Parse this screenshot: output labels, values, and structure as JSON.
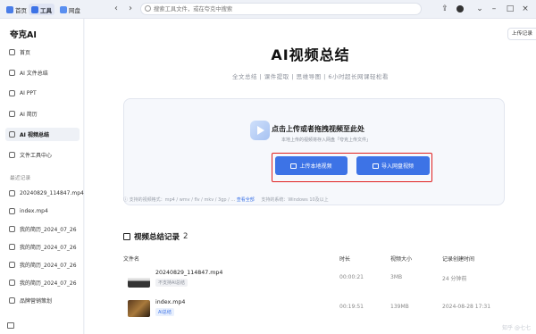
{
  "topbar": {
    "tabs": [
      {
        "label": "首页",
        "icon": "home-icon",
        "color": "#4a7de8"
      },
      {
        "label": "工具",
        "icon": "tools-icon",
        "color": "#3d73e6"
      },
      {
        "label": "网盘",
        "icon": "cloud-drive-icon",
        "color": "#5a8ff0"
      }
    ],
    "search_placeholder": "搜索工具文件，或在夸克中搜索"
  },
  "sidebar": {
    "brand": "夸克AI",
    "items": [
      {
        "label": "首页",
        "icon": "home-icon"
      },
      {
        "label": "AI 文件总结",
        "icon": "document-icon"
      },
      {
        "label": "AI PPT",
        "icon": "ppt-icon"
      },
      {
        "label": "AI 简历",
        "icon": "resume-icon"
      },
      {
        "label": "AI 视频总结",
        "icon": "video-icon",
        "active": true
      },
      {
        "label": "文件工具中心",
        "icon": "toolbox-icon"
      }
    ],
    "recent_header": "最近记录",
    "recent": [
      "20240829_114847.mp4",
      "index.mp4",
      "我的简历_2024_07_26",
      "我的简历_2024_07_26",
      "我的简历_2024_07_26",
      "我的简历_2024_07_26",
      "品牌营销策划"
    ]
  },
  "main": {
    "upload_record_button": "上传记录",
    "title": "AI视频总结",
    "subtitle": "全文总结 | 课件提取 | 思维导图 | 6小时超长网课轻松看",
    "upload": {
      "main_text": "点击上传或者拖拽视频至此处",
      "hint": "本地上传的视频将存入网盘「夸克上传文件」",
      "local_button": "上传本地视频",
      "cloud_button": "导入网盘视频",
      "formats": "支持的视频格式：mp4 / wmv / flv / mkv / 3gp / ...",
      "formats_link": "查看全部",
      "system": "支持的系统：Windows 10及以上"
    },
    "records": {
      "title": "视频总结记录",
      "count": "2",
      "columns": [
        "文件名",
        "时长",
        "视频大小",
        "记录创建时间"
      ],
      "rows": [
        {
          "name": "20240829_114847.mp4",
          "tag": "不支持AI总结",
          "tag_color": "#8a8f99",
          "duration": "00:00:21",
          "size": "3MB",
          "created": "24 分钟前"
        },
        {
          "name": "index.mp4",
          "tag": "AI总结",
          "tag_color": "#3d73e6",
          "duration": "00:19:51",
          "size": "139MB",
          "created": "2024-08-28 17:31"
        }
      ]
    },
    "watermark": "知乎 @七七"
  }
}
